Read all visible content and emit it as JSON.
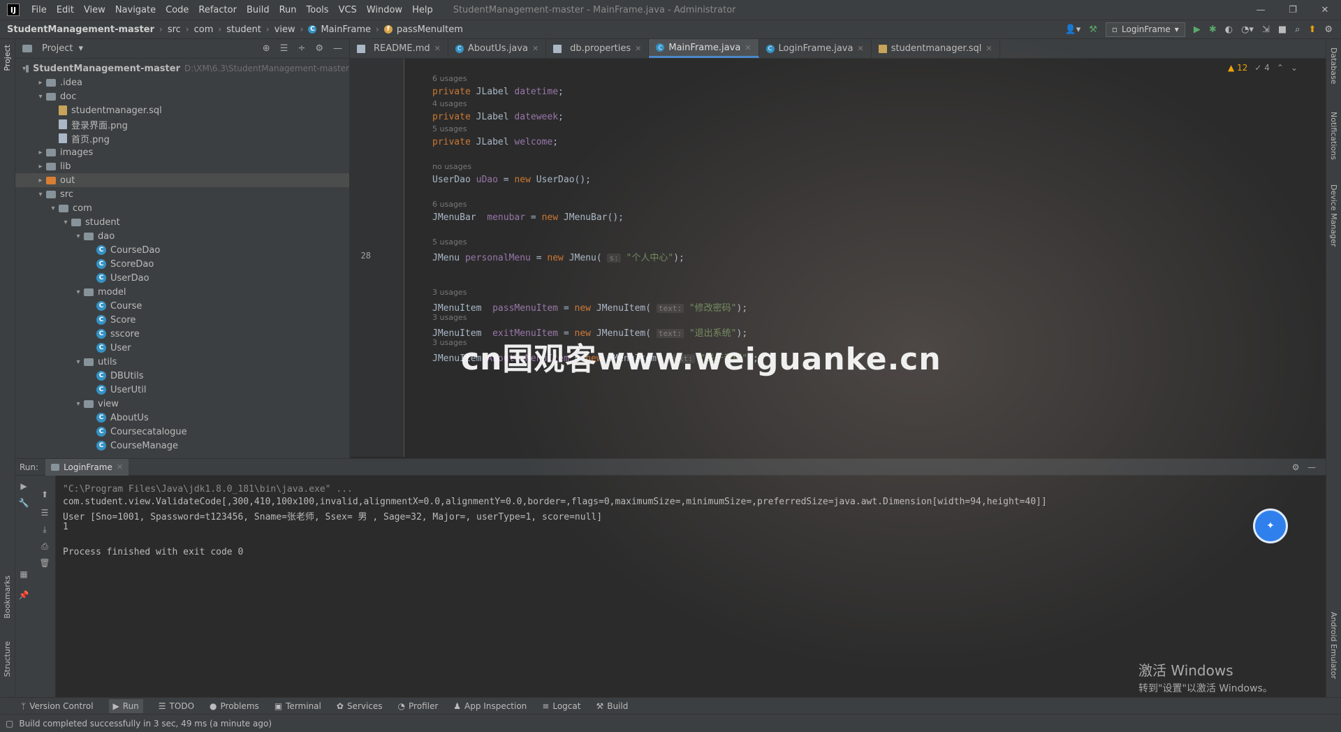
{
  "titlebar": {
    "logo": "IJ",
    "menu": [
      "File",
      "Edit",
      "View",
      "Navigate",
      "Code",
      "Refactor",
      "Build",
      "Run",
      "Tools",
      "VCS",
      "Window",
      "Help"
    ],
    "title": "StudentManagement-master - MainFrame.java - Administrator",
    "minimize": "—",
    "maximize": "❐",
    "close": "✕"
  },
  "navbar": {
    "crumbs": [
      "StudentManagement-master",
      "src",
      "com",
      "student",
      "view",
      "MainFrame",
      "passMenuItem"
    ],
    "run_config": "LoginFrame"
  },
  "project_panel": {
    "title": "Project",
    "tree": [
      {
        "label": "StudentManagement-master",
        "hint": "D:\\XM\\6.3\\StudentManagement-master",
        "type": "folder",
        "depth": 0,
        "arrow": "▾",
        "bold": true
      },
      {
        "label": ".idea",
        "type": "folder",
        "depth": 1,
        "arrow": "▸"
      },
      {
        "label": "doc",
        "type": "folder",
        "depth": 1,
        "arrow": "▾"
      },
      {
        "label": "studentmanager.sql",
        "type": "sql",
        "depth": 2,
        "arrow": ""
      },
      {
        "label": "登录界面.png",
        "type": "file",
        "depth": 2,
        "arrow": ""
      },
      {
        "label": "首页.png",
        "type": "file",
        "depth": 2,
        "arrow": ""
      },
      {
        "label": "images",
        "type": "folder",
        "depth": 1,
        "arrow": "▸"
      },
      {
        "label": "lib",
        "type": "folder",
        "depth": 1,
        "arrow": "▸"
      },
      {
        "label": "out",
        "type": "folder-orange",
        "depth": 1,
        "arrow": "▸",
        "selected": true
      },
      {
        "label": "src",
        "type": "folder",
        "depth": 1,
        "arrow": "▾"
      },
      {
        "label": "com",
        "type": "folder",
        "depth": 2,
        "arrow": "▾"
      },
      {
        "label": "student",
        "type": "folder",
        "depth": 3,
        "arrow": "▾"
      },
      {
        "label": "dao",
        "type": "folder",
        "depth": 4,
        "arrow": "▾"
      },
      {
        "label": "CourseDao",
        "type": "class",
        "depth": 5,
        "arrow": ""
      },
      {
        "label": "ScoreDao",
        "type": "class",
        "depth": 5,
        "arrow": ""
      },
      {
        "label": "UserDao",
        "type": "class",
        "depth": 5,
        "arrow": ""
      },
      {
        "label": "model",
        "type": "folder",
        "depth": 4,
        "arrow": "▾"
      },
      {
        "label": "Course",
        "type": "class",
        "depth": 5,
        "arrow": ""
      },
      {
        "label": "Score",
        "type": "class",
        "depth": 5,
        "arrow": ""
      },
      {
        "label": "sscore",
        "type": "class",
        "depth": 5,
        "arrow": ""
      },
      {
        "label": "User",
        "type": "class",
        "depth": 5,
        "arrow": ""
      },
      {
        "label": "utils",
        "type": "folder",
        "depth": 4,
        "arrow": "▾"
      },
      {
        "label": "DBUtils",
        "type": "class",
        "depth": 5,
        "arrow": ""
      },
      {
        "label": "UserUtil",
        "type": "class",
        "depth": 5,
        "arrow": ""
      },
      {
        "label": "view",
        "type": "folder",
        "depth": 4,
        "arrow": "▾"
      },
      {
        "label": "AboutUs",
        "type": "class",
        "depth": 5,
        "arrow": ""
      },
      {
        "label": "Coursecatalogue",
        "type": "class",
        "depth": 5,
        "arrow": ""
      },
      {
        "label": "CourseManage",
        "type": "class",
        "depth": 5,
        "arrow": ""
      }
    ]
  },
  "tabs": [
    {
      "label": "README.md",
      "icon": "file"
    },
    {
      "label": "AboutUs.java",
      "icon": "class"
    },
    {
      "label": "db.properties",
      "icon": "file"
    },
    {
      "label": "MainFrame.java",
      "icon": "class",
      "active": true
    },
    {
      "label": "LoginFrame.java",
      "icon": "class"
    },
    {
      "label": "studentmanager.sql",
      "icon": "sql"
    }
  ],
  "editor": {
    "inspections": {
      "warnings": "▲ 12",
      "weak": "✓ 4"
    },
    "lines": [
      {
        "num": "",
        "usage": "6 usages",
        "code": [
          {
            "t": "private ",
            "c": "kw"
          },
          {
            "t": "JLabel "
          },
          {
            "t": "datetime",
            "c": "fld"
          },
          {
            "t": ";"
          }
        ]
      },
      {
        "num": "",
        "usage": "4 usages",
        "code": [
          {
            "t": "private ",
            "c": "kw"
          },
          {
            "t": "JLabel "
          },
          {
            "t": "dateweek",
            "c": "fld"
          },
          {
            "t": ";"
          }
        ]
      },
      {
        "num": "",
        "usage": "5 usages",
        "code": [
          {
            "t": "private ",
            "c": "kw"
          },
          {
            "t": "JLabel "
          },
          {
            "t": "welcome",
            "c": "fld"
          },
          {
            "t": ";"
          }
        ]
      },
      {
        "num": "",
        "usage": "no usages",
        "code": [
          {
            "t": "UserDao "
          },
          {
            "t": "uDao",
            "c": "fld"
          },
          {
            "t": " = "
          },
          {
            "t": "new ",
            "c": "kw"
          },
          {
            "t": "UserDao();"
          }
        ]
      },
      {
        "num": "",
        "usage": "6 usages",
        "code": [
          {
            "t": "JMenuBar  "
          },
          {
            "t": "menubar",
            "c": "fld"
          },
          {
            "t": " = "
          },
          {
            "t": "new ",
            "c": "kw"
          },
          {
            "t": "JMenuBar();"
          }
        ]
      },
      {
        "num": "28",
        "usage": "5 usages",
        "code": [
          {
            "t": "JMenu "
          },
          {
            "t": "personalMenu",
            "c": "fld"
          },
          {
            "t": " = "
          },
          {
            "t": "new ",
            "c": "kw"
          },
          {
            "t": "JMenu( "
          },
          {
            "t": "s:",
            "c": "ph"
          },
          {
            "t": " \"个人中心\"",
            "c": "str"
          },
          {
            "t": ");"
          }
        ]
      },
      {
        "num": "",
        "usage": "3 usages",
        "code": [
          {
            "t": "JMenuItem  "
          },
          {
            "t": "passMenuItem",
            "c": "fld"
          },
          {
            "t": " = "
          },
          {
            "t": "new ",
            "c": "kw"
          },
          {
            "t": "JMenuItem( "
          },
          {
            "t": "text:",
            "c": "ph"
          },
          {
            "t": " \"修改密码\"",
            "c": "str"
          },
          {
            "t": ");"
          }
        ]
      },
      {
        "num": "",
        "usage": "3 usages",
        "code": [
          {
            "t": "JMenuItem  "
          },
          {
            "t": "exitMenuItem",
            "c": "fld"
          },
          {
            "t": " = "
          },
          {
            "t": "new ",
            "c": "kw"
          },
          {
            "t": "JMenuItem( "
          },
          {
            "t": "text:",
            "c": "ph"
          },
          {
            "t": " \"退出系统\"",
            "c": "str"
          },
          {
            "t": ");"
          }
        ]
      },
      {
        "num": "",
        "usage": "3 usages",
        "code": [
          {
            "t": "JMenuItem "
          },
          {
            "t": "AboutUsMenuItem",
            "c": "fld"
          },
          {
            "t": " = "
          },
          {
            "t": "new ",
            "c": "kw"
          },
          {
            "t": "JMenuItem( "
          },
          {
            "t": "text:",
            "c": "ph"
          },
          {
            "t": " \"关于我们\"",
            "c": "str"
          },
          {
            "t": ");"
          }
        ]
      }
    ]
  },
  "run_panel": {
    "label": "Run:",
    "tab": "LoginFrame",
    "output": [
      {
        "text": "\"C:\\Program Files\\Java\\jdk1.8.0_181\\bin\\java.exe\" ...",
        "kind": "path"
      },
      {
        "text": "com.student.view.ValidateCode[,300,410,100x100,invalid,alignmentX=0.0,alignmentY=0.0,border=,flags=0,maximumSize=,minimumSize=,preferredSize=java.awt.Dimension[width=94,height=40]]",
        "kind": "out"
      },
      {
        "text": "User [Sno=1001, Spassword=t123456, Sname=张老师, Ssex= 男 , Sage=32, Major=, userType=1, score=null]",
        "kind": "out"
      },
      {
        "text": "1",
        "kind": "out"
      },
      {
        "text": "",
        "kind": "out"
      },
      {
        "text": "Process finished with exit code 0",
        "kind": "out"
      }
    ]
  },
  "tool_windows": [
    {
      "label": "Version Control",
      "icon": "ᛘ"
    },
    {
      "label": "Run",
      "icon": "▶",
      "active": true
    },
    {
      "label": "TODO",
      "icon": "☰"
    },
    {
      "label": "Problems",
      "icon": "●"
    },
    {
      "label": "Terminal",
      "icon": "▣"
    },
    {
      "label": "Services",
      "icon": "✿"
    },
    {
      "label": "Profiler",
      "icon": "◔"
    },
    {
      "label": "App Inspection",
      "icon": "♟"
    },
    {
      "label": "Logcat",
      "icon": "≡"
    },
    {
      "label": "Build",
      "icon": "⚒"
    }
  ],
  "side_labels": {
    "left_top": "Project",
    "left_bottom": [
      "Bookmarks",
      "Structure"
    ],
    "right": [
      "Database",
      "Notifications",
      "Device Manager",
      "Android Emulator"
    ]
  },
  "statusbar": {
    "text": "Build completed successfully in 3 sec, 49 ms (a minute ago)"
  },
  "watermark": "cn国观客www.weiguanke.cn",
  "activation": {
    "line1": "激活 Windows",
    "line2": "转到\"设置\"以激活 Windows。"
  },
  "colors": {
    "accent": "#4a88c7",
    "keyword": "#cc7832",
    "field": "#9876aa",
    "string": "#6a8759",
    "class": "#3592c4"
  }
}
